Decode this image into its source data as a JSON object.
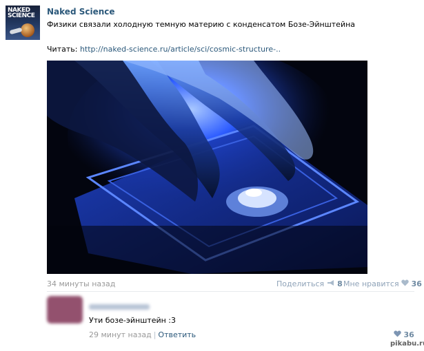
{
  "post": {
    "author": "Naked Science",
    "avatar_logo_lines": [
      "NAKED",
      "SCIENCE"
    ],
    "text": "Физики связали холодную темную материю с конденсатом Бозе-Эйнштейна",
    "link_prefix": "Читать: ",
    "link_text": "http://naked-science.ru/article/sci/cosmic-structure-..",
    "time": "34 минуты назад",
    "share_label": "Поделиться",
    "share_count": "8",
    "like_label": "Мне нравится",
    "like_count": "36"
  },
  "comment": {
    "text": "Ути бозе-эйнштейн :3",
    "time": "29 минут назад",
    "separator": "|",
    "reply_label": "Ответить",
    "like_count": "36"
  },
  "watermark": "pikabu.ru",
  "icons": {
    "share": "megaphone-icon",
    "like": "heart-icon"
  },
  "colors": {
    "link": "#2b587a",
    "meta": "#999999",
    "action": "#8fa3b8"
  }
}
